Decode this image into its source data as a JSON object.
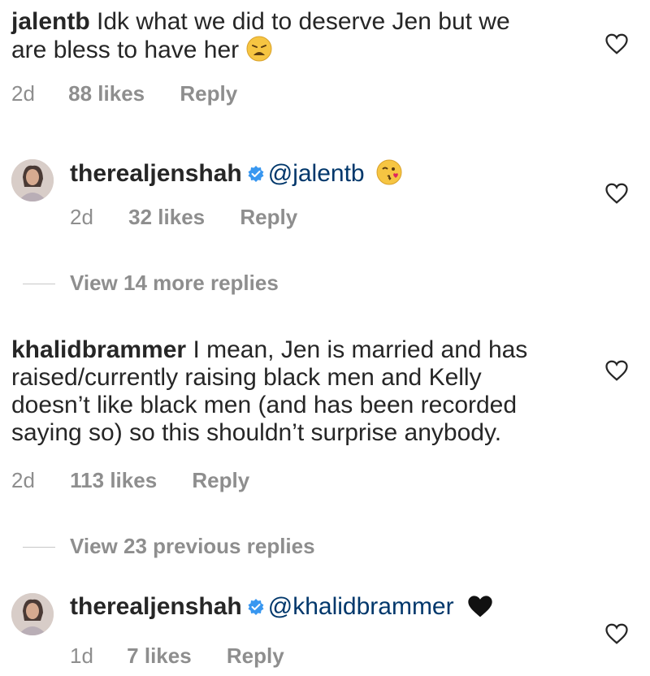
{
  "comments": [
    {
      "username": "jalentb",
      "text_line1": "Idk what we did to deserve Jen but we",
      "text_line2": "are bless to have her",
      "emoji": "weary-face",
      "time": "2d",
      "likes": "88 likes",
      "reply": "Reply"
    },
    {
      "username": "therealjenshah",
      "verified": true,
      "mention": "@jalentb",
      "emoji": "face-blowing-kiss",
      "time": "2d",
      "likes": "32 likes",
      "reply": "Reply"
    },
    {
      "username": "khalidbrammer",
      "text_line1": "I mean, Jen is married and has",
      "text_line2": "raised/currently raising black men and Kelly",
      "text_line3": "doesn’t like black men (and has been recorded",
      "text_line4": "saying so) so this shouldn’t surprise anybody.",
      "time": "2d",
      "likes": "113 likes",
      "reply": "Reply"
    },
    {
      "username": "therealjenshah",
      "verified": true,
      "mention": "@khalidbrammer",
      "emoji": "black-heart",
      "time": "1d",
      "likes": "7 likes",
      "reply": "Reply"
    }
  ],
  "view_more_1": "View 14 more replies",
  "view_more_2": "View 23 previous replies",
  "colors": {
    "text": "#262626",
    "muted": "#8e8e8e",
    "verified": "#3897f0",
    "mention": "#00376b"
  }
}
